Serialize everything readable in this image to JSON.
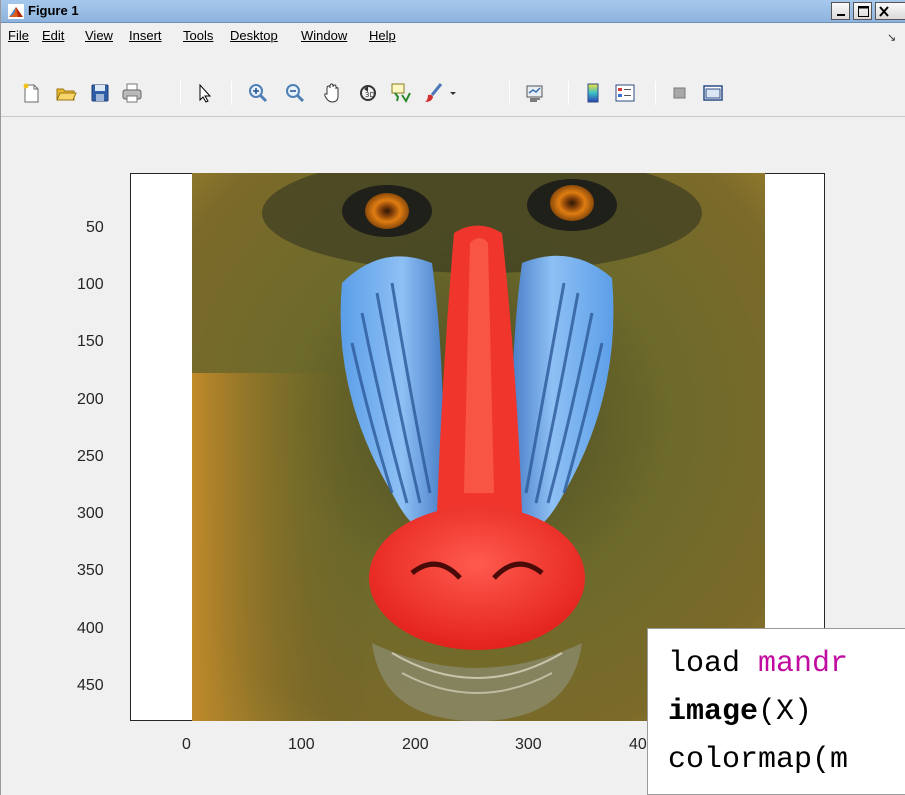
{
  "window": {
    "title": "Figure 1"
  },
  "menu": [
    "File",
    "Edit",
    "View",
    "Insert",
    "Tools",
    "Desktop",
    "Window",
    "Help"
  ],
  "toolbar_icons": [
    "new-file-icon",
    "open-folder-icon",
    "save-icon",
    "print-icon",
    "pointer-icon",
    "zoom-in-icon",
    "zoom-out-icon",
    "pan-hand-icon",
    "rotate-3d-icon",
    "data-cursor-icon",
    "brush-icon",
    "brush-dropdown-icon",
    "link-plot-icon",
    "colorbar-icon",
    "legend-icon",
    "hide-plot-tools-icon",
    "show-plot-tools-icon"
  ],
  "axes": {
    "y_ticks": [
      "50",
      "100",
      "150",
      "200",
      "250",
      "300",
      "350",
      "400",
      "450"
    ],
    "x_ticks": [
      "0",
      "100",
      "200",
      "300",
      "40"
    ]
  },
  "code": {
    "line1_cmd": "load ",
    "line1_arg": "mandr",
    "line2_fn": "image",
    "line2_args": "(X)",
    "line3": "colormap(m"
  }
}
